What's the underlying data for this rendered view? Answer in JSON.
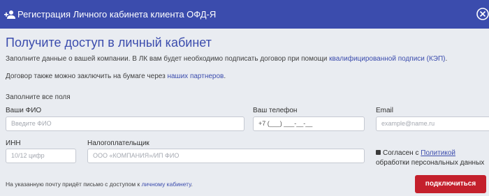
{
  "header": {
    "title": "Регистрация Личного кабинета клиента ОФД-Я",
    "bg_color": "#3b4cad"
  },
  "intro": {
    "heading": "Получите доступ в личный кабинет",
    "p1_text": "Заполните данные о вашей компании. В ЛК вам будет необходимо подписать договор при помощи ",
    "p1_link": "квалифицированной подписи (КЭП)",
    "p1_end": ".",
    "p2_text": "Договор также можно заключить на бумаге через ",
    "p2_link": "наших партнеров",
    "p2_end": "."
  },
  "form": {
    "fill_all": "Заполните все поля",
    "fio": {
      "label": "Ваши ФИО",
      "placeholder": "Введите ФИО"
    },
    "phone": {
      "label": "Ваш телефон",
      "value": "+7 (___) ___-__-__"
    },
    "email": {
      "label": "Email",
      "placeholder": "example@name.ru"
    },
    "inn": {
      "label": "ИНН",
      "placeholder": "10/12 цифр"
    },
    "taxpayer": {
      "label": "Налогоплательщик",
      "placeholder": "ООО «КОМПАНИЯ»/ИП ФИО"
    },
    "consent": {
      "checked": true,
      "text_before": "Согласен с ",
      "link": "Политикой",
      "text_after": "обработки персональных данных"
    }
  },
  "footer": {
    "note_text": "На указанную почту придёт письмо с доступом к ",
    "note_link": "личному кабинету",
    "note_end": ".",
    "submit_label": "подключиться",
    "submit_color": "#c4202c"
  }
}
